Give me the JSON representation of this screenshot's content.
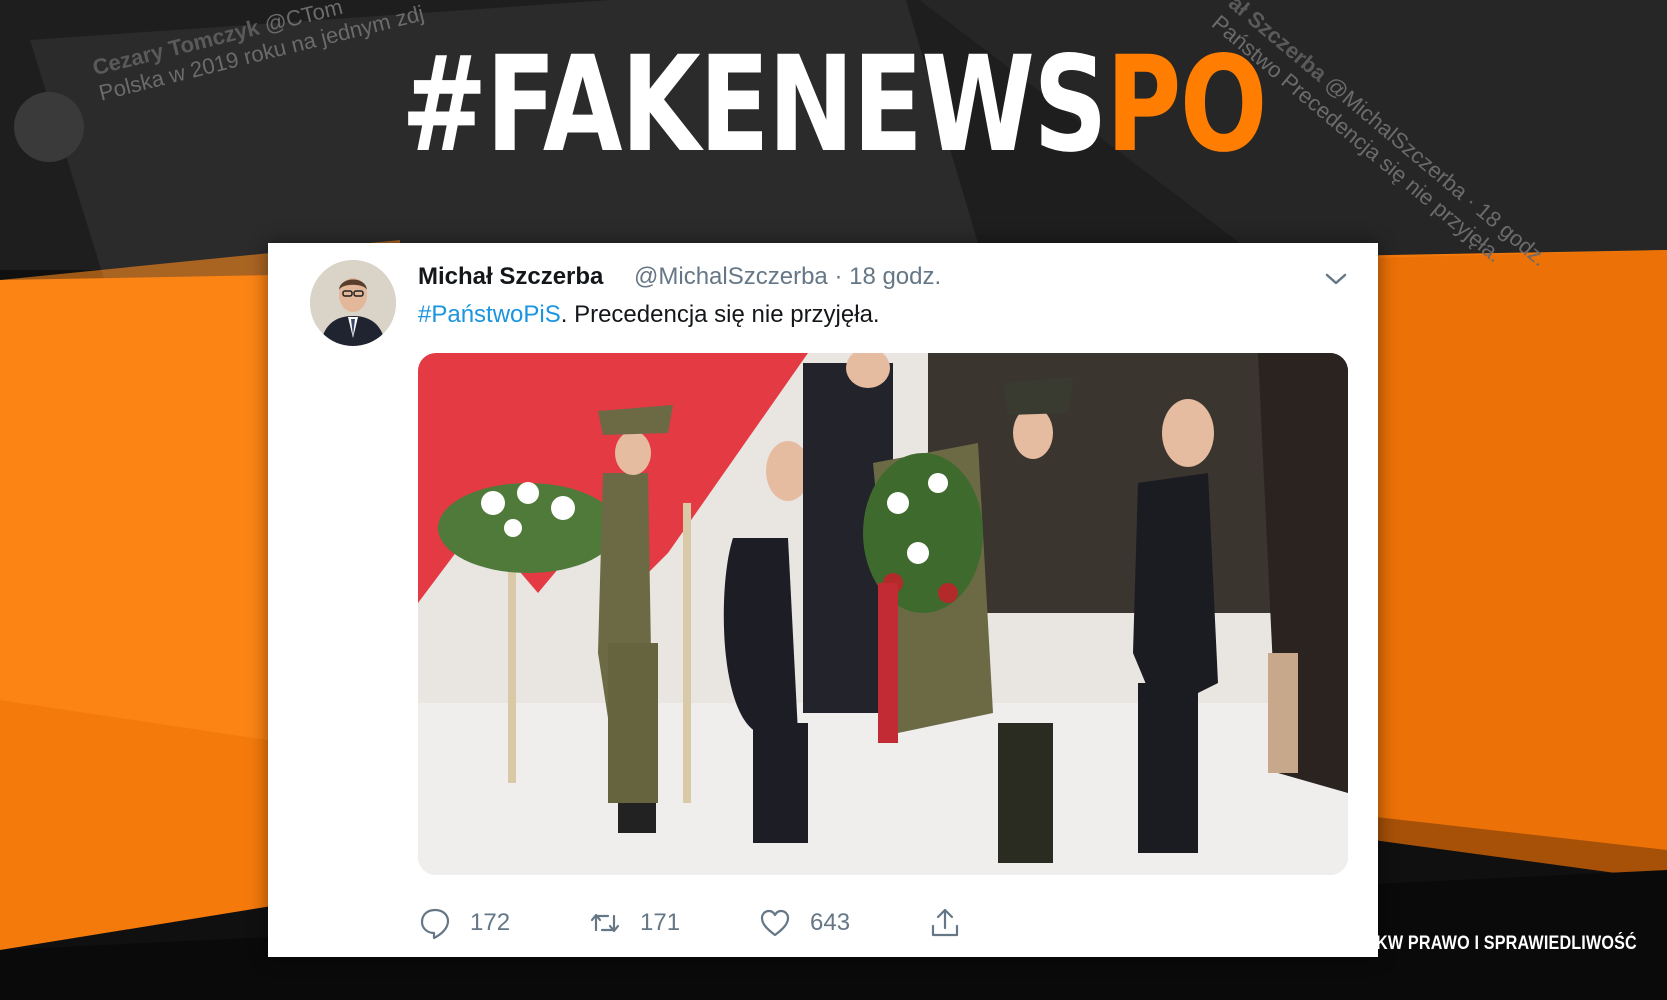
{
  "banner": {
    "main": "#FAKENEWS",
    "accent": "PO"
  },
  "background_tweets": [
    {
      "name": "Cezary Tomczyk",
      "handle": "@CTom",
      "text": "Polska w 2019 roku na jednym zdj"
    },
    {
      "name": "ał Szczerba",
      "handle": "@MichalSzczerba · 18 godz.",
      "text": "Państwo Precedencja się nie przyjęła."
    }
  ],
  "tweet": {
    "name": "Michał Szczerba",
    "handle": "@MichalSzczerba",
    "time": "· 18 godz.",
    "hashtag": "#PaństwoPiS",
    "text": ". Precedencja się nie przyjęła.",
    "replies": "172",
    "retweets": "171",
    "likes": "643"
  },
  "footer": "KW PRAWO I SPRAWIEDLIWOŚĆ",
  "colors": {
    "accent": "#ff7d00",
    "link": "#1b95e0",
    "muted": "#657786"
  },
  "icons": [
    "chevron-down-icon",
    "reply-icon",
    "retweet-icon",
    "like-icon",
    "share-icon"
  ]
}
